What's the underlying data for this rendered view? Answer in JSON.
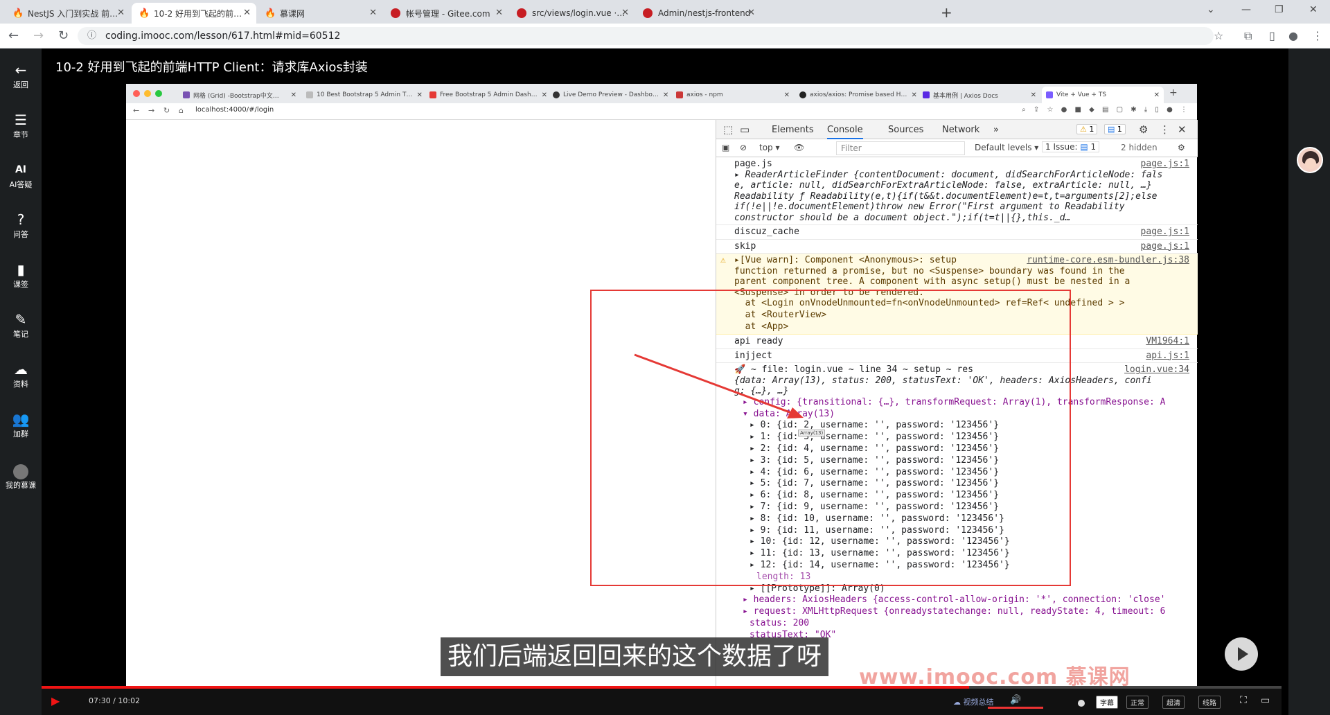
{
  "browser": {
    "tabs": [
      {
        "label": "NestJS 入门到实战 前端必学…"
      },
      {
        "label": "10-2 好用到飞起的前端HTTP …"
      },
      {
        "label": "慕课网"
      },
      {
        "label": "帐号管理 - Gitee.com"
      },
      {
        "label": "src/views/login.vue · Admin…"
      },
      {
        "label": "Admin/nestjs-frontend"
      }
    ],
    "url": "coding.imooc.com/lesson/617.html#mid=60512"
  },
  "rail": {
    "items": [
      {
        "label": "返回",
        "icon": "back-arrow-icon"
      },
      {
        "label": "章节",
        "icon": "menu-icon"
      },
      {
        "label": "AI答疑",
        "icon": "ai-icon"
      },
      {
        "label": "问答",
        "icon": "question-icon"
      },
      {
        "label": "课签",
        "icon": "bookmark-icon"
      },
      {
        "label": "笔记",
        "icon": "pencil-icon"
      },
      {
        "label": "资料",
        "icon": "cloud-download-icon"
      },
      {
        "label": "加群",
        "icon": "group-icon"
      },
      {
        "label": "我的慕课",
        "icon": "avatar-icon"
      }
    ]
  },
  "lesson_title": "10-2 好用到飞起的前端HTTP Client：请求库Axios封装",
  "inner_browser": {
    "tabs": [
      {
        "label": "网格 (Grid) -Bootstrap中文…",
        "color": "#7952b3"
      },
      {
        "label": "10 Best Bootstrap 5 Admin T…",
        "color": "#bbbbbb"
      },
      {
        "label": "Free Bootstrap 5 Admin Dash…",
        "color": "#e53935"
      },
      {
        "label": "Live Demo Preview - Dashbo…",
        "color": "#333333"
      },
      {
        "label": "axios - npm",
        "color": "#cb3837"
      },
      {
        "label": "axios/axios: Promise based H…",
        "color": "#222222"
      },
      {
        "label": "基本用例 | Axios Docs",
        "color": "#5a29e4"
      },
      {
        "label": "Vite + Vue + TS",
        "color": "#7a5cff"
      }
    ],
    "url": "localhost:4000/#/login"
  },
  "devtools": {
    "tabs": [
      "Elements",
      "Console",
      "Sources",
      "Network"
    ],
    "active_tab": "Console",
    "warnings_badge": "1",
    "messages_badge": "1",
    "context": "top",
    "filter_placeholder": "Filter",
    "levels": "Default levels",
    "issues": "1 Issue:",
    "issues_count": "1",
    "hidden": "2 hidden"
  },
  "console": {
    "m1": {
      "text": "page.js",
      "src": "page.js:1"
    },
    "m1b": "ReaderArticleFinder {contentDocument: document, didSearchForArticleNode: fals",
    "m1c": "e, article: null, didSearchForExtraArticleNode: false, extraArticle: null, …}",
    "m1d": "Readability ƒ Readability(e,t){if(t&&t.documentElement)e=t,t=arguments[2];else",
    "m1e": "if(!e||!e.documentElement)throw new Error(\"First argument to Readability",
    "m1f": "constructor should be a document object.\");if(t=t||{},this._d…",
    "m2": {
      "text": "discuz_cache",
      "src": "page.js:1"
    },
    "m3": {
      "text": "skip",
      "src": "page.js:1"
    },
    "warn": {
      "src": "runtime-core.esm-bundler.js:38",
      "lines": [
        "▸[Vue warn]: Component <Anonymous>: setup",
        "function returned a promise, but no <Suspense> boundary was found in the",
        "parent component tree. A component with async setup() must be nested in a",
        "<Suspense> in order to be rendered.",
        "  at <Login onVnodeUnmounted=fn<onVnodeUnmounted> ref=Ref< undefined > >",
        "  at <RouterView>",
        "  at <App>"
      ]
    },
    "m4": {
      "text": "api ready",
      "src": "VM1964:1"
    },
    "m5": {
      "text": "injject",
      "src": "api.js:1"
    },
    "res": {
      "header": "🚀 ~ file: login.vue ~ line 34 ~ setup ~ res",
      "src": "login.vue:34",
      "summary1": "{data: Array(13), status: 200, statusText: 'OK', headers: AxiosHeaders, confi",
      "summary2": "g: {…}, …}",
      "config": "▸ config: {transitional: {…}, transformRequest: Array(1), transformResponse: A",
      "data": "▾ data: Array(13)",
      "rows": [
        "▸ 0: {id: 2, username: '', password: '123456'}",
        "▸ 1: {id: 3, username: '', password: '123456'}",
        "▸ 2: {id: 4, username: '', password: '123456'}",
        "▸ 3: {id: 5, username: '', password: '123456'}",
        "▸ 4: {id: 6, username: '', password: '123456'}",
        "▸ 5: {id: 7, username: '', password: '123456'}",
        "▸ 6: {id: 8, username: '', password: '123456'}",
        "▸ 7: {id: 9, username: '', password: '123456'}",
        "▸ 8: {id: 10, username: '', password: '123456'}",
        "▸ 9: {id: 11, username: '', password: '123456'}",
        "▸ 10: {id: 12, username: '', password: '123456'}",
        "▸ 11: {id: 13, username: '', password: '123456'}",
        "▸ 12: {id: 14, username: '', password: '123456'}"
      ],
      "length": "length: 13",
      "prototype": "▸ [[Prototype]]: Array(0)",
      "headers": "▸ headers: AxiosHeaders {access-control-allow-origin: '*', connection: 'close'",
      "request": "▸ request: XMLHttpRequest {onreadystatechange: null, readyState: 4, timeout: 6",
      "status": "status: 200",
      "statusText": "statusText: \"OK\""
    },
    "tooltip": "Array(13)"
  },
  "subtitle": "我们后端返回回来的这个数据了呀",
  "watermark": "www.imooc.com  慕课网",
  "player": {
    "time": "07:30 / 10:02",
    "progress": 0.748,
    "summary": "视频总结",
    "subtitle_btn": "字幕",
    "quality_normal": "正常",
    "quality_hd": "超清",
    "line": "线路"
  },
  "colors": {
    "accent": "#f01414",
    "highlight": "#e53935"
  }
}
